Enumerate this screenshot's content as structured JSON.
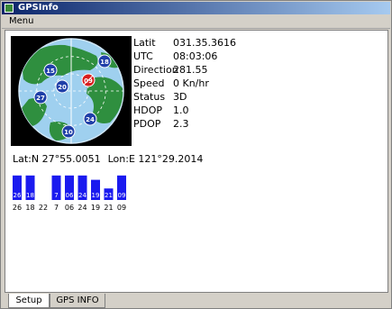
{
  "window": {
    "title": "GPSInfo"
  },
  "menu": {
    "items": [
      "Menu"
    ]
  },
  "gps_info": {
    "rows": [
      {
        "label": "Latit",
        "value": "031.35.3616"
      },
      {
        "label": "UTC",
        "value": "08:03:06"
      },
      {
        "label": "Direction",
        "value": "281.55"
      },
      {
        "label": "Speed",
        "value": "0 Kn/hr"
      },
      {
        "label": "Status",
        "value": "3D"
      },
      {
        "label": "HDOP",
        "value": "1.0"
      },
      {
        "label": "PDOP",
        "value": "2.3"
      }
    ]
  },
  "status_line": {
    "left": "Lat:N 27°55.0051",
    "right": "Lon:E 121°29.2014"
  },
  "satellites": {
    "skyplot": [
      {
        "id": "15",
        "color": "#1f3fa8"
      },
      {
        "id": "20",
        "color": "#1f3fa8"
      },
      {
        "id": "27",
        "color": "#1f3fa8"
      },
      {
        "id": "09",
        "color": "#d81e1e"
      },
      {
        "id": "18",
        "color": "#1f3fa8"
      },
      {
        "id": "24",
        "color": "#1f3fa8"
      },
      {
        "id": "10",
        "color": "#1f3fa8"
      }
    ],
    "bars": [
      {
        "id": "26",
        "level": 0.85
      },
      {
        "id": "18",
        "level": 0.85
      },
      {
        "id": "22",
        "level": 0.0
      },
      {
        "id": "7",
        "level": 0.85
      },
      {
        "id": "06",
        "level": 0.85
      },
      {
        "id": "24",
        "level": 0.85
      },
      {
        "id": "19",
        "level": 0.7
      },
      {
        "id": "21",
        "level": 0.4
      },
      {
        "id": "09",
        "level": 0.85
      }
    ],
    "bar_color": "#1a1aef"
  },
  "tabs": [
    {
      "label": "Setup",
      "active": true
    },
    {
      "label": "GPS INFO",
      "active": false
    }
  ]
}
